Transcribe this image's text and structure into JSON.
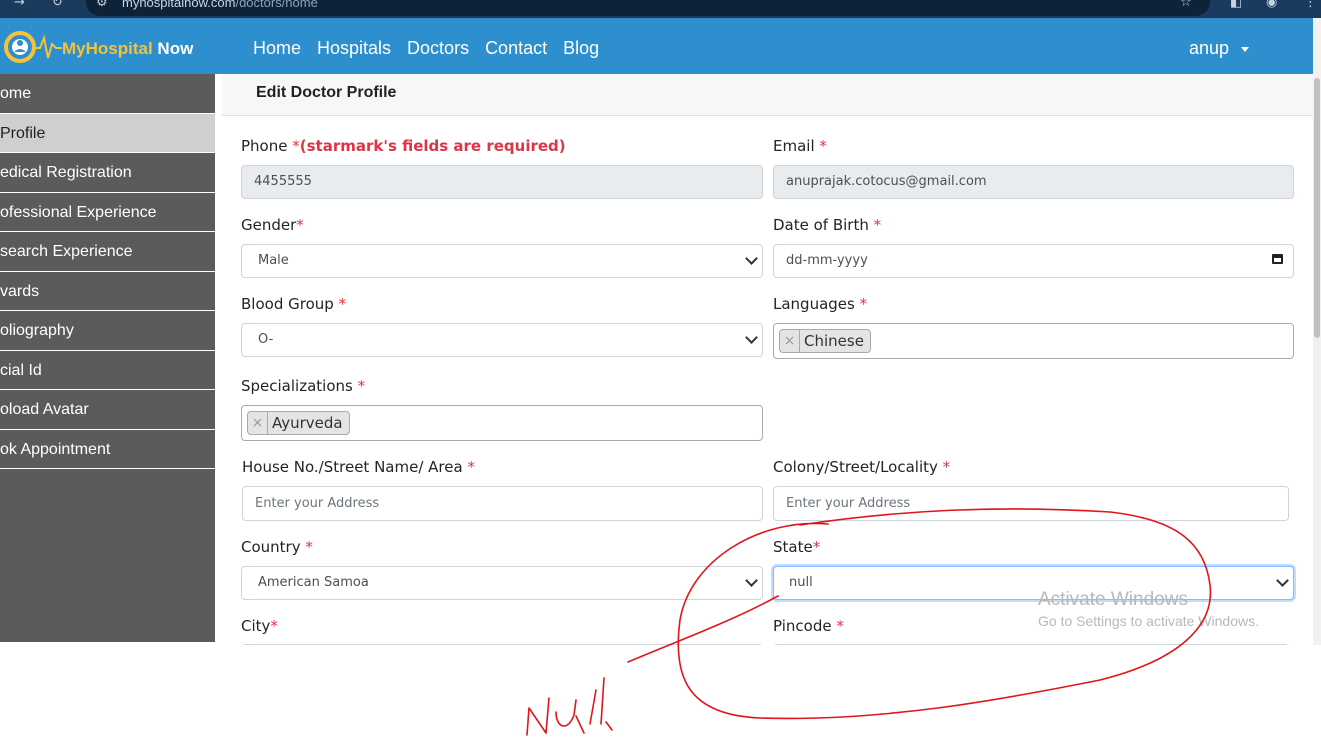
{
  "browser": {
    "url_host": "myhospitalnow.com",
    "url_path": "/doctors/home"
  },
  "navbar": {
    "brand_main": "MyHospital",
    "brand_suffix": "Now",
    "links": [
      "Home",
      "Hospitals",
      "Doctors",
      "Contact",
      "Blog"
    ],
    "user": "anup"
  },
  "sidebar": {
    "items": [
      {
        "label": "ome",
        "active": false
      },
      {
        "label": "Profile",
        "active": true
      },
      {
        "label": "edical Registration",
        "active": false
      },
      {
        "label": "ofessional Experience",
        "active": false
      },
      {
        "label": "search Experience",
        "active": false
      },
      {
        "label": "vards",
        "active": false
      },
      {
        "label": "oliography",
        "active": false
      },
      {
        "label": "cial Id",
        "active": false
      },
      {
        "label": "oload Avatar",
        "active": false
      },
      {
        "label": "ok Appointment",
        "active": false
      }
    ]
  },
  "form": {
    "title": "Edit Doctor Profile",
    "phone": {
      "label": "Phone",
      "star": "*",
      "note": "(starmark's fields are required)",
      "value": "4455555"
    },
    "email": {
      "label": "Email",
      "star": "*",
      "value": "anuprajak.cotocus@gmail.com"
    },
    "gender": {
      "label": "Gender",
      "star": "*",
      "value": "Male"
    },
    "dob": {
      "label": "Date of Birth",
      "star": "*",
      "placeholder": "dd-mm-yyyy"
    },
    "blood_group": {
      "label": "Blood Group",
      "star": "*",
      "value": "O-"
    },
    "languages": {
      "label": "Languages",
      "star": "*",
      "tags": [
        "Chinese"
      ]
    },
    "specializations": {
      "label": "Specializations",
      "star": "*",
      "tags": [
        "Ayurveda"
      ]
    },
    "house": {
      "label": "House No./Street Name/ Area",
      "star": "*",
      "placeholder": "Enter your Address"
    },
    "colony": {
      "label": "Colony/Street/Locality",
      "star": "*",
      "placeholder": "Enter your Address"
    },
    "country": {
      "label": "Country",
      "star": "*",
      "value": "American Samoa"
    },
    "state": {
      "label": "State",
      "star": "*",
      "value": "null"
    },
    "city": {
      "label": "City",
      "star": "*"
    },
    "pincode": {
      "label": "Pincode",
      "star": "*"
    }
  },
  "watermark": {
    "title": "Activate Windows",
    "subtitle": "Go to Settings to activate Windows."
  },
  "annotation": {
    "text": "null",
    "color": "#e0161a"
  }
}
